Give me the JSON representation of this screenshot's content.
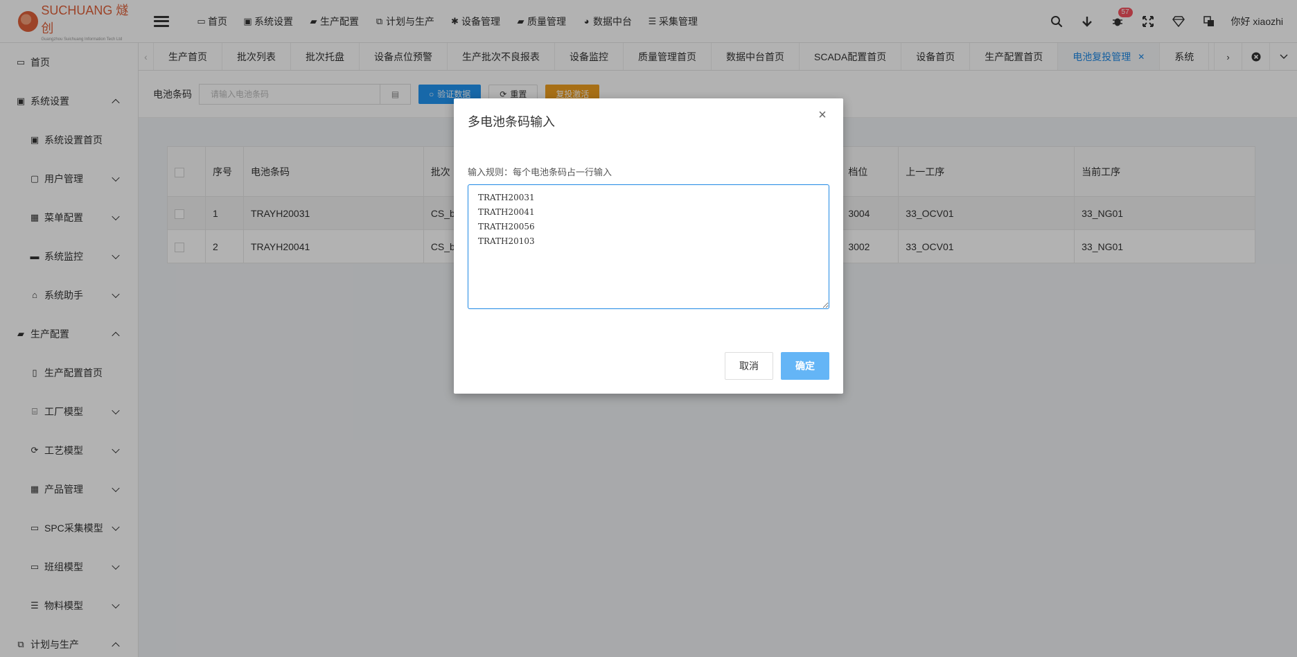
{
  "logo": {
    "text": "SUCHUANG 燧创",
    "subtext": "Guangzhou Suichuang Information Tech Ltd"
  },
  "topnav": [
    {
      "label": "首页",
      "icon": "monitor-icon"
    },
    {
      "label": "系统设置",
      "icon": "lock-icon"
    },
    {
      "label": "生产配置",
      "icon": "briefcase-icon"
    },
    {
      "label": "计划与生产",
      "icon": "windows-icon"
    },
    {
      "label": "设备管理",
      "icon": "gear-icon"
    },
    {
      "label": "质量管理",
      "icon": "briefcase-icon"
    },
    {
      "label": "数据中台",
      "icon": "pie-chart-icon"
    },
    {
      "label": "采集管理",
      "icon": "database-icon"
    }
  ],
  "header": {
    "notification_count": "57",
    "greeting": "你好 xiaozhi"
  },
  "sidebar": {
    "items": [
      {
        "label": "首页",
        "level": 1,
        "icon": "monitor-icon",
        "arrow": ""
      },
      {
        "label": "系统设置",
        "level": 1,
        "icon": "lock-icon",
        "arrow": "up"
      },
      {
        "label": "系统设置首页",
        "level": 2,
        "icon": "lock-icon",
        "arrow": ""
      },
      {
        "label": "用户管理",
        "level": 2,
        "icon": "id-card-icon",
        "arrow": "down"
      },
      {
        "label": "菜单配置",
        "level": 2,
        "icon": "grid-icon",
        "arrow": "down"
      },
      {
        "label": "系统监控",
        "level": 2,
        "icon": "screen-icon",
        "arrow": "down"
      },
      {
        "label": "系统助手",
        "level": 2,
        "icon": "home-icon",
        "arrow": "down"
      },
      {
        "label": "生产配置",
        "level": 1,
        "icon": "briefcase-icon",
        "arrow": "up"
      },
      {
        "label": "生产配置首页",
        "level": 2,
        "icon": "file-icon",
        "arrow": ""
      },
      {
        "label": "工厂模型",
        "level": 2,
        "icon": "bank-icon",
        "arrow": "down"
      },
      {
        "label": "工艺模型",
        "level": 2,
        "icon": "recycle-icon",
        "arrow": "down"
      },
      {
        "label": "产品管理",
        "level": 2,
        "icon": "grid-icon",
        "arrow": "down"
      },
      {
        "label": "SPC采集模型",
        "level": 2,
        "icon": "folder-icon",
        "arrow": "down"
      },
      {
        "label": "班组模型",
        "level": 2,
        "icon": "folder-icon",
        "arrow": "down"
      },
      {
        "label": "物料模型",
        "level": 2,
        "icon": "list-icon",
        "arrow": "down"
      },
      {
        "label": "计划与生产",
        "level": 1,
        "icon": "windows-icon",
        "arrow": "up"
      }
    ]
  },
  "tabs": [
    {
      "label": "生产首页",
      "active": false
    },
    {
      "label": "批次列表",
      "active": false
    },
    {
      "label": "批次托盘",
      "active": false
    },
    {
      "label": "设备点位预警",
      "active": false
    },
    {
      "label": "生产批次不良报表",
      "active": false
    },
    {
      "label": "设备监控",
      "active": false
    },
    {
      "label": "质量管理首页",
      "active": false
    },
    {
      "label": "数据中台首页",
      "active": false
    },
    {
      "label": "SCADA配置首页",
      "active": false
    },
    {
      "label": "设备首页",
      "active": false
    },
    {
      "label": "生产配置首页",
      "active": false
    },
    {
      "label": "电池复投管理",
      "active": true
    },
    {
      "label": "系统",
      "active": false
    }
  ],
  "toolbar": {
    "label": "电池条码",
    "placeholder": "请输入电池条码",
    "verify_label": "验证数据",
    "reset_label": "重置",
    "reactivate_label": "复投激活"
  },
  "table": {
    "headers": [
      "序号",
      "电池条码",
      "批次",
      "档位",
      "上一工序",
      "当前工序"
    ],
    "rows": [
      {
        "no": "1",
        "code": "TRAYH20031",
        "batch": "CS_b",
        "grade": "3004",
        "prev": "33_OCV01",
        "curr": "33_NG01"
      },
      {
        "no": "2",
        "code": "TRAYH20041",
        "batch": "CS_b",
        "grade": "3002",
        "prev": "33_OCV01",
        "curr": "33_NG01"
      }
    ]
  },
  "modal": {
    "title": "多电池条码输入",
    "rule": "输入规则：每个电池条码占一行输入",
    "textarea_value": "TRATH20031\nTRATH20041\nTRATH20056\nTRATH20103",
    "cancel_label": "取消",
    "ok_label": "确定"
  },
  "colors": {
    "accent": "#1e88e5",
    "ok_button": "#64b5f6",
    "reactivate_button": "#f0a020",
    "badge": "#f5525f"
  }
}
